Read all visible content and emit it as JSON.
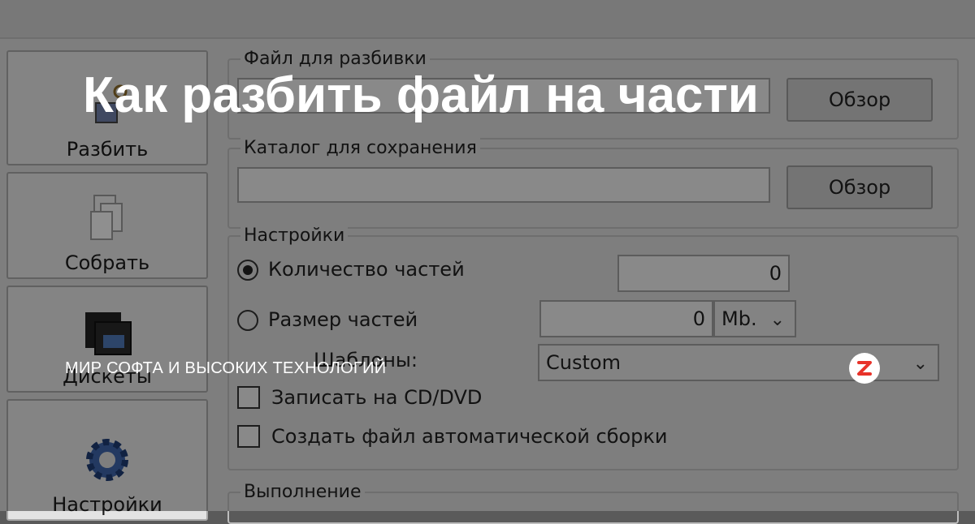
{
  "headline": "Как разбить файл на части",
  "brand": {
    "name": "МИР СОФТА И ВЫСОКИХ ТЕХНОЛОГИЙ",
    "logo_icon": "zen-logo-icon",
    "accent": "#e8332a"
  },
  "sidebar": {
    "items": [
      {
        "label": "Разбить",
        "icon": "split-file-icon"
      },
      {
        "label": "Собрать",
        "icon": "merge-files-icon"
      },
      {
        "label": "Дискеты",
        "icon": "floppy-disk-icon"
      },
      {
        "label": "Настройки",
        "icon": "gear-icon"
      }
    ]
  },
  "form": {
    "file_label": "Файл для разбивки",
    "file_value": "",
    "browse_label": "Обзор",
    "folder_label": "Каталог для сохранения",
    "folder_value": "",
    "browse2_label": "Обзор",
    "settings_label": "Настройки",
    "parts_count_label": "Количество частей",
    "parts_count_value": "0",
    "part_size_label": "Размер частей",
    "part_size_value": "0",
    "unit": "Mb.",
    "templates_label": "Шаблоны:",
    "template_value": "Custom",
    "burn_label": "Записать на CD/DVD",
    "autobuild_label": "Создать файл автоматической сборки",
    "progress_label": "Выполнение"
  }
}
